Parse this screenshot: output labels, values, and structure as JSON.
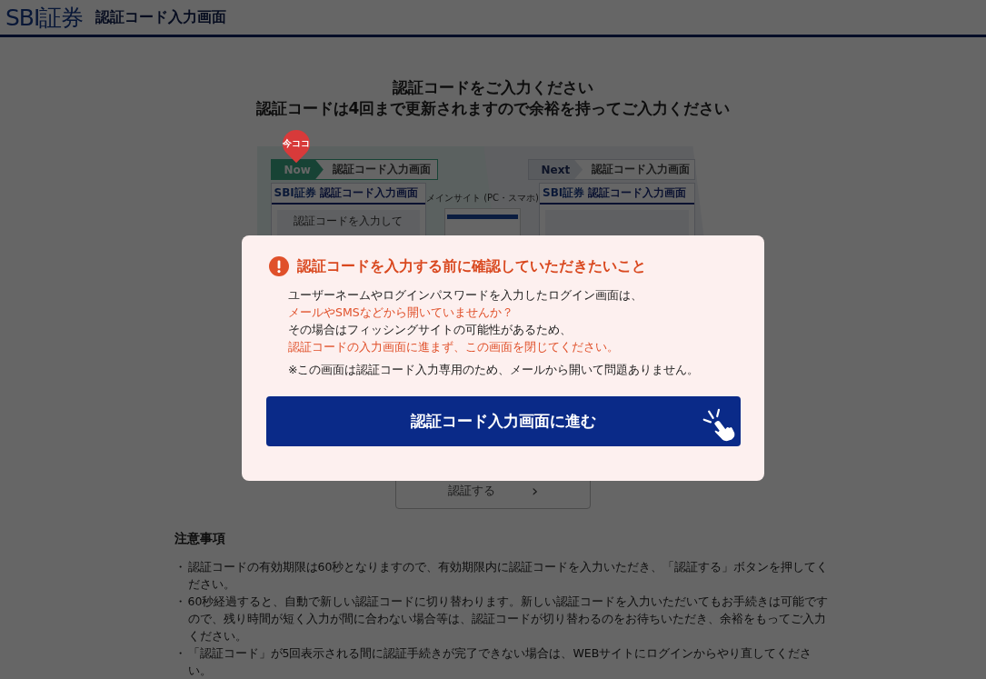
{
  "header": {
    "logo": "SBI証券",
    "title": "認証コード入力画面"
  },
  "heading": [
    "認証コードをご入力ください",
    "認証コードは4回まで更新されますので余裕を持ってご入力ください"
  ],
  "illustration": {
    "pin": "今ココ",
    "steps": [
      {
        "label": "Now",
        "screen": "認証コード入力画面",
        "selected": true
      },
      {
        "label": "Next",
        "screen": "認証コード入力画面",
        "selected": false
      }
    ],
    "mini_screens": [
      {
        "logo": "SBI証券",
        "title": "認証コード入力画面",
        "body": "認証コードを入力して"
      },
      {
        "logo": "SBI証券",
        "title": "認証コード入力画面"
      }
    ],
    "middle_label": "メインサイト (PC・スマホ)"
  },
  "submit_button": {
    "label": "認証する",
    "arrow": "›"
  },
  "notes": {
    "title": "注意事項",
    "items": [
      {
        "bullet": "・",
        "text": "認証コードの有効期限は60秒となりますので、有効期限内に認証コードを入力いただき、「認証する」ボタンを押してください。"
      },
      {
        "bullet": "・",
        "text": "60秒経過すると、自動で新しい認証コードに切り替わります。新しい認証コードを入力いただいてもお手続きは可能ですので、残り時間が短く入力が間に合わない場合等は、認証コードが切り替わるのをお待ちいただき、余裕をもってご入力ください。"
      },
      {
        "bullet": "・",
        "text": "「認証コード」が5回表示される間に認証手続きが完了できない場合は、WEBサイトにログインからやり直してください。"
      }
    ]
  },
  "modal": {
    "title": "認証コードを入力する前に確認していただきたいこと",
    "lines": [
      {
        "kind": "normal",
        "text": "ユーザーネームやログインパスワードを入力したログイン画面は、"
      },
      {
        "kind": "alert",
        "text": "メールやSMSなどから開いていませんか？"
      },
      {
        "kind": "normal",
        "text": "その場合はフィッシングサイトの可能性があるため、"
      },
      {
        "kind": "alert",
        "text": "認証コードの入力画面に進まず、この画面を閉じてください。"
      },
      {
        "kind": "note",
        "text": "※この画面は認証コード入力専用のため、メールから開いて問題ありません。"
      }
    ],
    "button": "認証コード入力画面に進む"
  }
}
